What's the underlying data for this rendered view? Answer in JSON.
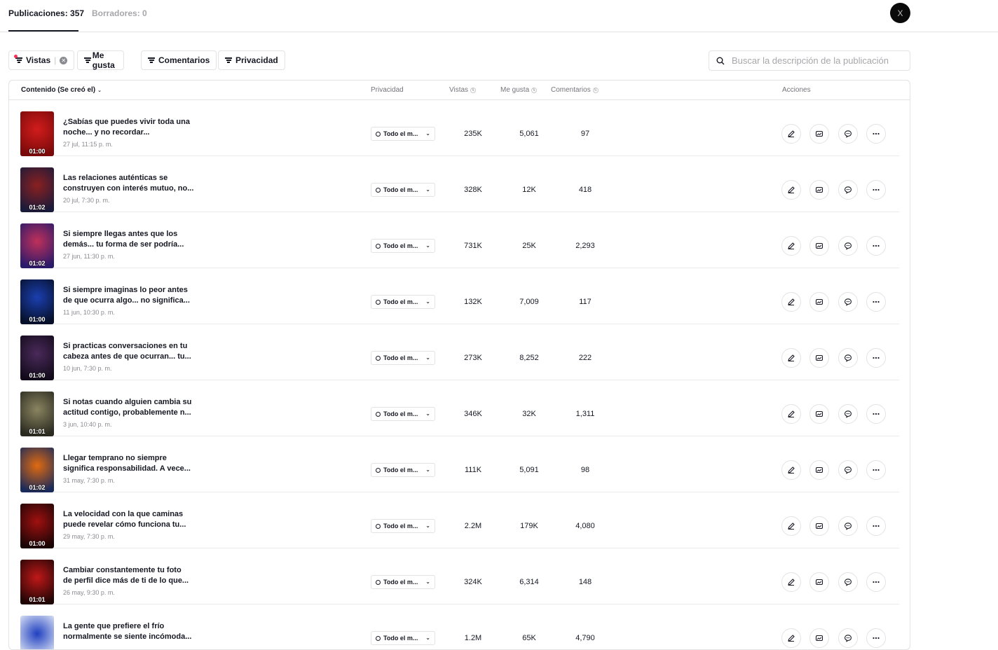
{
  "tabs": {
    "published": "Publicaciones: 357",
    "drafts": "Borradores: 0"
  },
  "avatar_letter": "X",
  "filters": {
    "views": "Vistas",
    "views_sep": "|",
    "likes": "Me gusta",
    "comments": "Comentarios",
    "privacy": "Privacidad"
  },
  "search": {
    "placeholder": "Buscar la descripción de la publicación"
  },
  "columns": {
    "content": "Contenido (Se creó el)",
    "privacy": "Privacidad",
    "views": "Vistas",
    "likes": "Me gusta",
    "comments": "Comentarios",
    "actions": "Acciones"
  },
  "rows": [
    {
      "line1": "¿Sabías que puedes vivir toda una",
      "line2": "noche... y no recordar...",
      "date": "27 jul, 11:15 p. m.",
      "duration": "01:00",
      "privacy": "Todo el m...",
      "views": "235K",
      "likes": "5,061",
      "comments": "97",
      "thumb_colors": [
        "#7a0a0a",
        "#d21c1c"
      ]
    },
    {
      "line1": "Las relaciones auténticas se",
      "line2": "construyen con interés mutuo, no...",
      "date": "20 jul, 7:30 p. m.",
      "duration": "01:02",
      "privacy": "Todo el m...",
      "views": "328K",
      "likes": "12K",
      "comments": "418",
      "thumb_colors": [
        "#1a1a3a",
        "#8a2020"
      ]
    },
    {
      "line1": "Si siempre llegas antes que los",
      "line2": "demás... tu forma de ser podría...",
      "date": "27 jun, 11:30 p. m.",
      "duration": "01:02",
      "privacy": "Todo el m...",
      "views": "731K",
      "likes": "25K",
      "comments": "2,293",
      "thumb_colors": [
        "#2a1a6a",
        "#c0305a"
      ]
    },
    {
      "line1": "Si siempre imaginas lo peor antes",
      "line2": "de que ocurra algo... no significa...",
      "date": "11 jun, 10:30 p. m.",
      "duration": "01:00",
      "privacy": "Todo el m...",
      "views": "132K",
      "likes": "7,009",
      "comments": "117",
      "thumb_colors": [
        "#06102a",
        "#1b3fb0"
      ]
    },
    {
      "line1": "Si practicas conversaciones en tu",
      "line2": "cabeza antes de que ocurran... tu...",
      "date": "10 jun, 7:30 p. m.",
      "duration": "01:00",
      "privacy": "Todo el m...",
      "views": "273K",
      "likes": "8,252",
      "comments": "222",
      "thumb_colors": [
        "#120a1a",
        "#4a2a5a"
      ]
    },
    {
      "line1": "Si notas cuando alguien cambia su",
      "line2": "actitud contigo, probablemente n...",
      "date": "3 jun, 10:40 p. m.",
      "duration": "01:01",
      "privacy": "Todo el m...",
      "views": "346K",
      "likes": "32K",
      "comments": "1,311",
      "thumb_colors": [
        "#2a2a20",
        "#8a8460"
      ]
    },
    {
      "line1": "Llegar temprano no siempre",
      "line2": "significa responsabilidad. A vece...",
      "date": "31 may, 7:30 p. m.",
      "duration": "01:02",
      "privacy": "Todo el m...",
      "views": "111K",
      "likes": "5,091",
      "comments": "98",
      "thumb_colors": [
        "#1a2a5a",
        "#e06a10"
      ]
    },
    {
      "line1": "La velocidad con la que caminas",
      "line2": "puede revelar cómo funciona tu...",
      "date": "29 may, 7:30 p. m.",
      "duration": "01:00",
      "privacy": "Todo el m...",
      "views": "2.2M",
      "likes": "179K",
      "comments": "4,080",
      "thumb_colors": [
        "#1a0505",
        "#a01010"
      ]
    },
    {
      "line1": "Cambiar constantemente tu foto",
      "line2": "de perfil dice más de ti de lo que...",
      "date": "26 may, 9:30 p. m.",
      "duration": "01:01",
      "privacy": "Todo el m...",
      "views": "324K",
      "likes": "6,314",
      "comments": "148",
      "thumb_colors": [
        "#200505",
        "#c01818"
      ]
    },
    {
      "line1": "La gente que prefiere el frío",
      "line2": "normalmente se siente incómoda...",
      "date": "",
      "duration": "",
      "privacy": "Todo el m...",
      "views": "1.2M",
      "likes": "65K",
      "comments": "4,790",
      "thumb_colors": [
        "#e8eef8",
        "#2040c0"
      ]
    }
  ]
}
